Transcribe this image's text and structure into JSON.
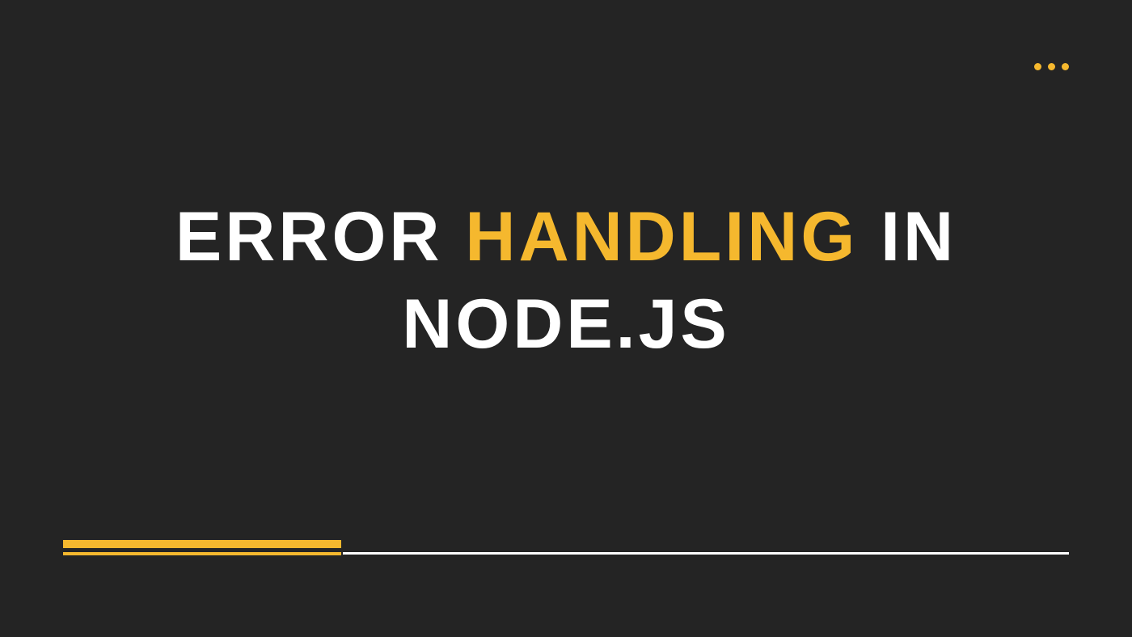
{
  "title": {
    "line1": {
      "word1": "ERROR",
      "word2": "HANDLING",
      "word3": "IN"
    },
    "line2": "NODE.JS"
  },
  "colors": {
    "background": "#242424",
    "accent": "#f5b82e",
    "text": "#ffffff"
  }
}
